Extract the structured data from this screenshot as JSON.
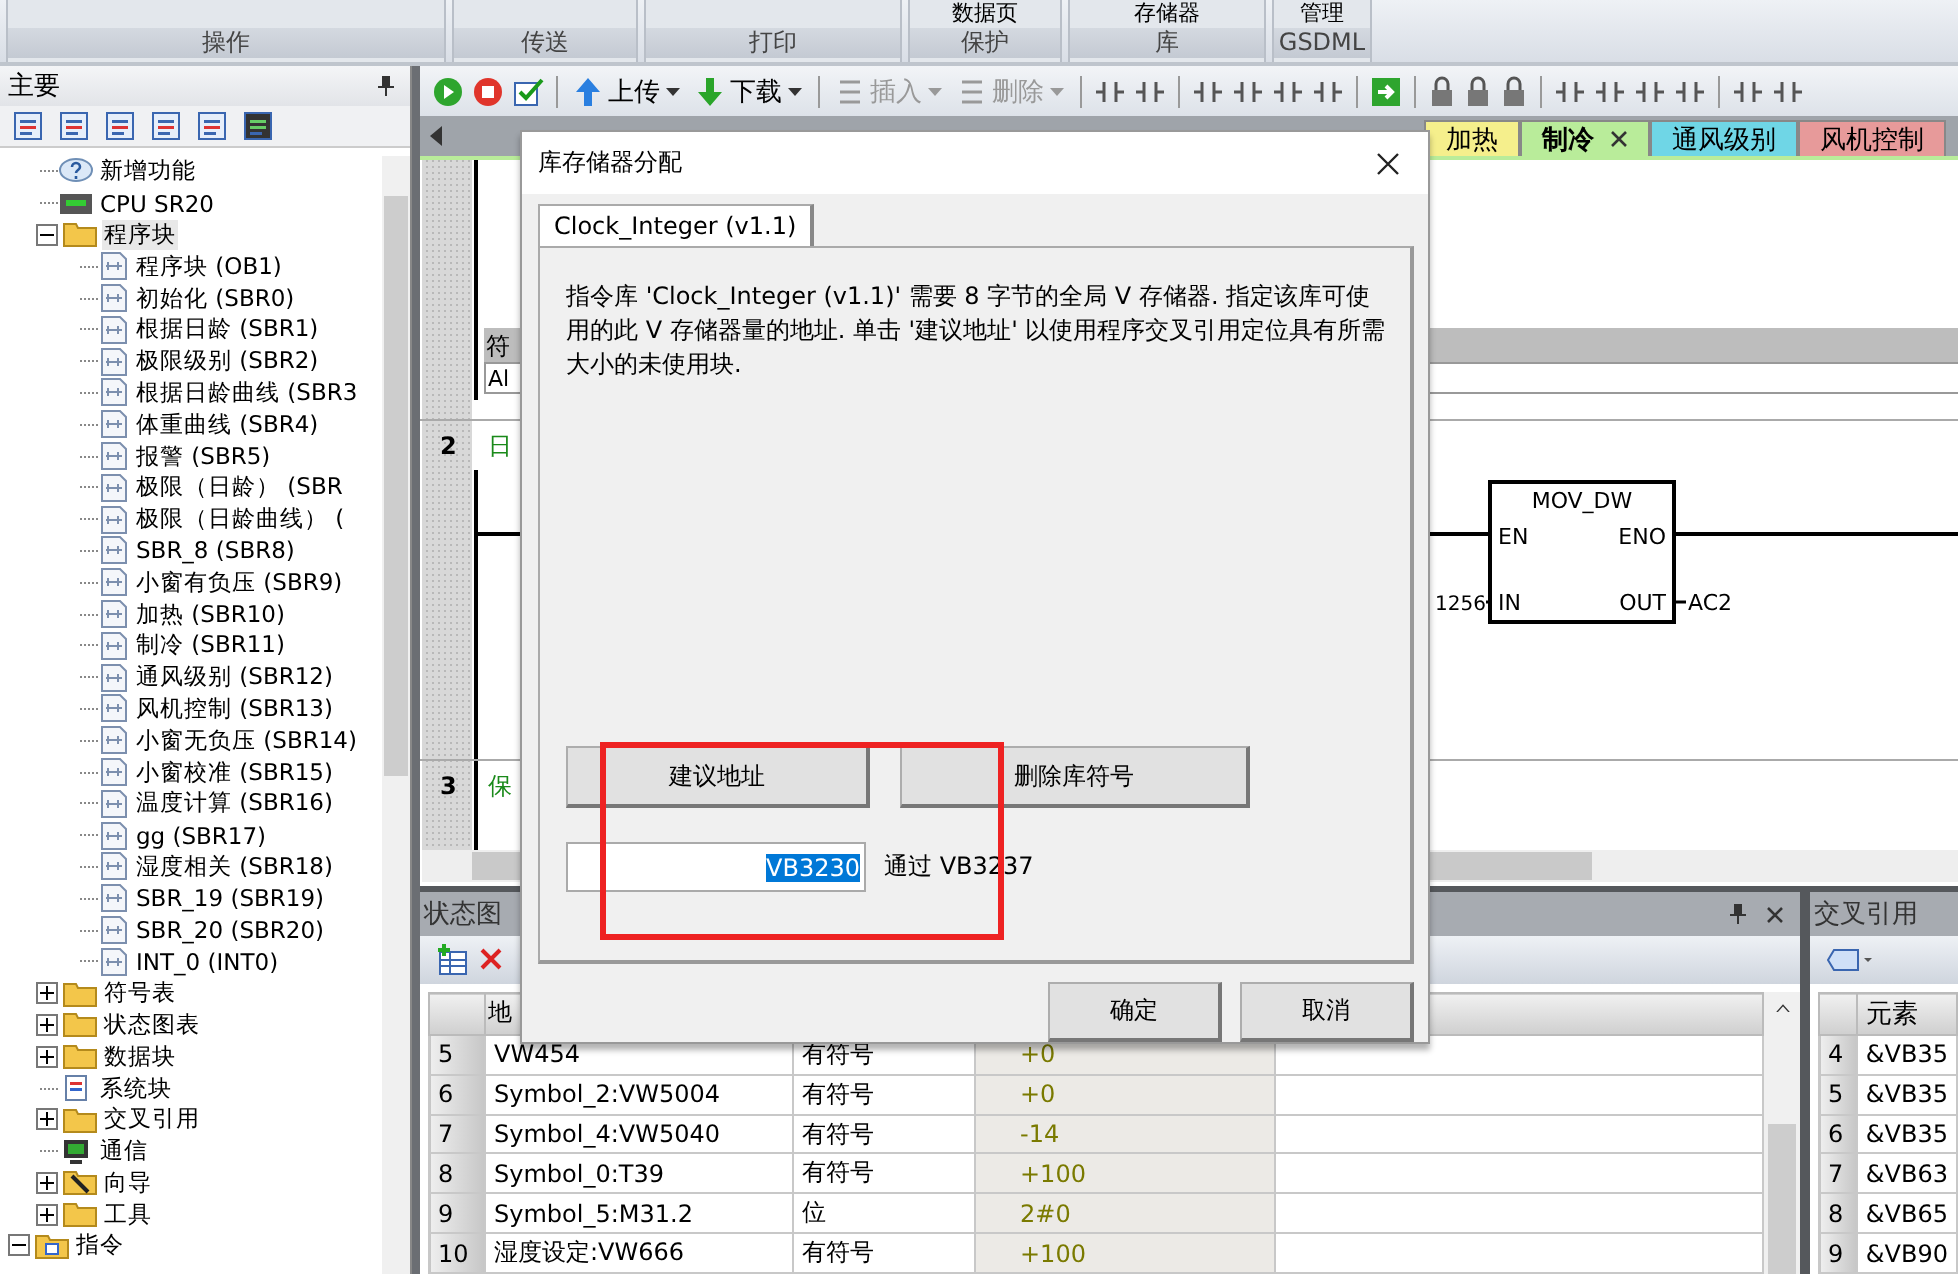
{
  "ribbon": {
    "groups": [
      {
        "label": "操作"
      },
      {
        "label": "传送"
      },
      {
        "label": "打印"
      },
      {
        "label": "保护",
        "button": "数据页"
      },
      {
        "label": "库",
        "button": "存储器"
      },
      {
        "label": "GSDML",
        "button": "管理"
      }
    ]
  },
  "left_panel": {
    "title": "主要",
    "project_items": [
      {
        "label": "新增功能",
        "kind": "help"
      },
      {
        "label": "CPU SR20",
        "kind": "cpu"
      },
      {
        "label": "程序块",
        "kind": "folder",
        "expanded": true,
        "selected": true,
        "children": [
          {
            "label": "程序块 (OB1)"
          },
          {
            "label": "初始化 (SBR0)"
          },
          {
            "label": "根据日龄 (SBR1)"
          },
          {
            "label": "极限级别 (SBR2)"
          },
          {
            "label": "根据日龄曲线 (SBR3"
          },
          {
            "label": "体重曲线 (SBR4)"
          },
          {
            "label": "报警 (SBR5)"
          },
          {
            "label": "极限（日龄） (SBR"
          },
          {
            "label": "极限（日龄曲线） ("
          },
          {
            "label": "SBR_8 (SBR8)"
          },
          {
            "label": "小窗有负压 (SBR9)"
          },
          {
            "label": "加热 (SBR10)"
          },
          {
            "label": "制冷 (SBR11)"
          },
          {
            "label": "通风级别 (SBR12)"
          },
          {
            "label": "风机控制 (SBR13)"
          },
          {
            "label": "小窗无负压 (SBR14)"
          },
          {
            "label": "小窗校准 (SBR15)"
          },
          {
            "label": "温度计算 (SBR16)"
          },
          {
            "label": "gg (SBR17)"
          },
          {
            "label": "湿度相关 (SBR18)"
          },
          {
            "label": "SBR_19 (SBR19)"
          },
          {
            "label": "SBR_20 (SBR20)"
          },
          {
            "label": "INT_0 (INT0)"
          }
        ]
      },
      {
        "label": "符号表",
        "kind": "folder",
        "expanded": false,
        "selected": false
      },
      {
        "label": "状态图表",
        "kind": "folder",
        "expanded": false,
        "selected": false
      },
      {
        "label": "数据块",
        "kind": "folder",
        "expanded": false,
        "selected": false
      },
      {
        "label": "系统块",
        "kind": "system"
      },
      {
        "label": "交叉引用",
        "kind": "folder",
        "expanded": false,
        "selected": false
      },
      {
        "label": "通信",
        "kind": "comm"
      },
      {
        "label": "向导",
        "kind": "wizard",
        "expanded": false,
        "selected": false
      },
      {
        "label": "工具",
        "kind": "folder",
        "expanded": false,
        "selected": false
      }
    ],
    "root_items": [
      {
        "label": "指令",
        "kind": "folder",
        "expanded": true,
        "selected": false
      }
    ]
  },
  "toolbar": [
    {
      "kind": "run"
    },
    {
      "kind": "stop"
    },
    {
      "kind": "check"
    },
    {
      "kind": "sep"
    },
    {
      "kind": "upload",
      "label": "上传",
      "disabled": false
    },
    {
      "kind": "download",
      "label": "下载",
      "disabled": false
    },
    {
      "kind": "sep"
    },
    {
      "kind": "insert",
      "label": "插入",
      "disabled": true
    },
    {
      "kind": "delete",
      "label": "删除",
      "disabled": true
    },
    {
      "kind": "sep"
    },
    {
      "kind": "tool"
    },
    {
      "kind": "tool"
    },
    {
      "kind": "sep"
    },
    {
      "kind": "tool"
    },
    {
      "kind": "tool"
    },
    {
      "kind": "tool"
    },
    {
      "kind": "tool"
    },
    {
      "kind": "sep"
    },
    {
      "kind": "go"
    },
    {
      "kind": "sep"
    },
    {
      "kind": "lock"
    },
    {
      "kind": "lock"
    },
    {
      "kind": "lock"
    },
    {
      "kind": "sep"
    },
    {
      "kind": "tool"
    },
    {
      "kind": "tool"
    },
    {
      "kind": "tool"
    },
    {
      "kind": "tool"
    },
    {
      "kind": "sep"
    },
    {
      "kind": "tool"
    },
    {
      "kind": "tool"
    }
  ],
  "tabs": [
    {
      "label": "加热",
      "color": "#f5ef8c",
      "selected": false
    },
    {
      "label": "制冷",
      "color": "#b9ec9a",
      "selected": true
    },
    {
      "label": "通风级别",
      "color": "#6fd6e6",
      "selected": false
    },
    {
      "label": "风机控制",
      "color": "#e79a9a",
      "selected": false
    }
  ],
  "editor": {
    "symbol_header": "符",
    "symbol_cell": "Al",
    "networks": [
      {
        "number": "2",
        "title": "日"
      },
      {
        "number": "3",
        "title": "保"
      }
    ],
    "block": {
      "name": "MOV_DW",
      "en": "EN",
      "eno": "ENO",
      "in": "IN",
      "out": "OUT",
      "in_value": "1256",
      "out_value": "AC2"
    }
  },
  "status_chart": {
    "title": "状态图",
    "header": "地",
    "rows": [
      {
        "index": "5",
        "address": "VW454",
        "format": "有符号",
        "value": "+0"
      },
      {
        "index": "6",
        "address": "Symbol_2:VW5004",
        "format": "有符号",
        "value": "+0"
      },
      {
        "index": "7",
        "address": "Symbol_4:VW5040",
        "format": "有符号",
        "value": "-14"
      },
      {
        "index": "8",
        "address": "Symbol_0:T39",
        "format": "有符号",
        "value": "+100"
      },
      {
        "index": "9",
        "address": "Symbol_5:M31.2",
        "format": "位",
        "value": "2#0"
      },
      {
        "index": "10",
        "address": "湿度设定:VW666",
        "format": "有符号",
        "value": "+100"
      }
    ]
  },
  "cross_reference": {
    "title": "交叉引用",
    "header": "元素",
    "rows": [
      {
        "index": "4",
        "element": "&VB35"
      },
      {
        "index": "5",
        "element": "&VB35"
      },
      {
        "index": "6",
        "element": "&VB35"
      },
      {
        "index": "7",
        "element": "&VB63"
      },
      {
        "index": "8",
        "element": "&VB65"
      },
      {
        "index": "9",
        "element": "&VB90"
      }
    ]
  },
  "dialog": {
    "title": "库存储器分配",
    "tab": "Clock_Integer (v1.1)",
    "message": "指令库 'Clock_Integer (v1.1)' 需要 8 字节的全局 V 存储器. 指定该库可使用的此 V 存储器量的地址. 单击 '建议地址' 以使用程序交叉引用定位具有所需大小的未使用块.",
    "suggest_button": "建议地址",
    "delete_button": "删除库符号",
    "address": "VB3230",
    "range": "通过 VB3237",
    "ok": "确定",
    "cancel": "取消"
  }
}
